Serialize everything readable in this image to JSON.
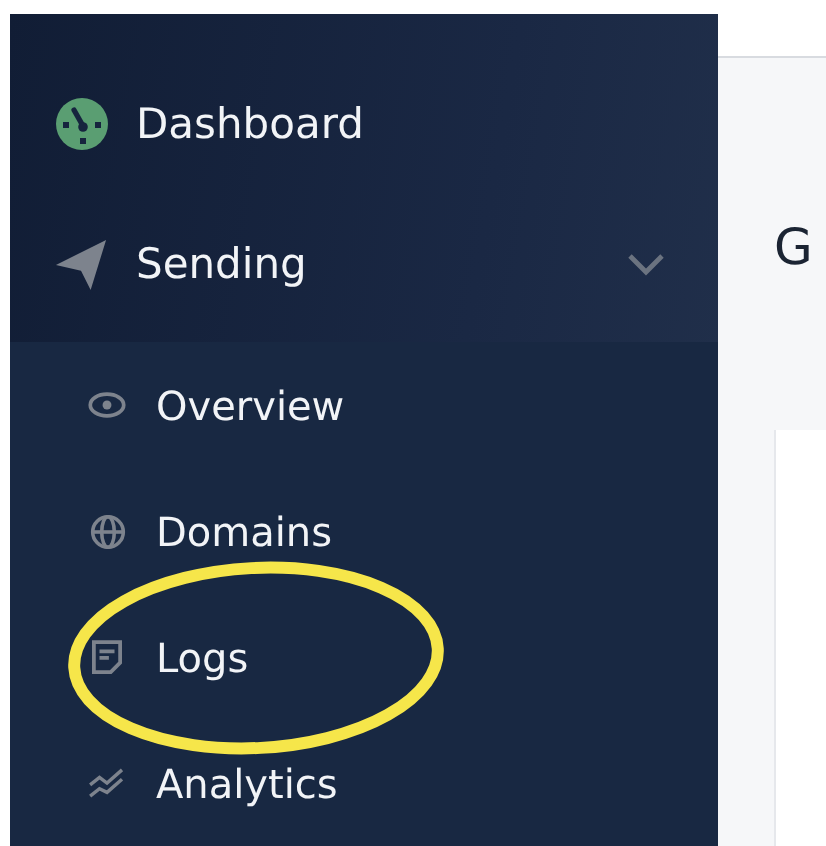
{
  "sidebar": {
    "items": [
      {
        "label": "Dashboard"
      },
      {
        "label": "Sending",
        "expanded": true,
        "children": [
          {
            "label": "Overview",
            "highlighted": false
          },
          {
            "label": "Domains",
            "highlighted": false
          },
          {
            "label": "Logs",
            "highlighted": true
          },
          {
            "label": "Analytics",
            "highlighted": false
          }
        ]
      }
    ]
  },
  "main": {
    "heading": "G"
  }
}
